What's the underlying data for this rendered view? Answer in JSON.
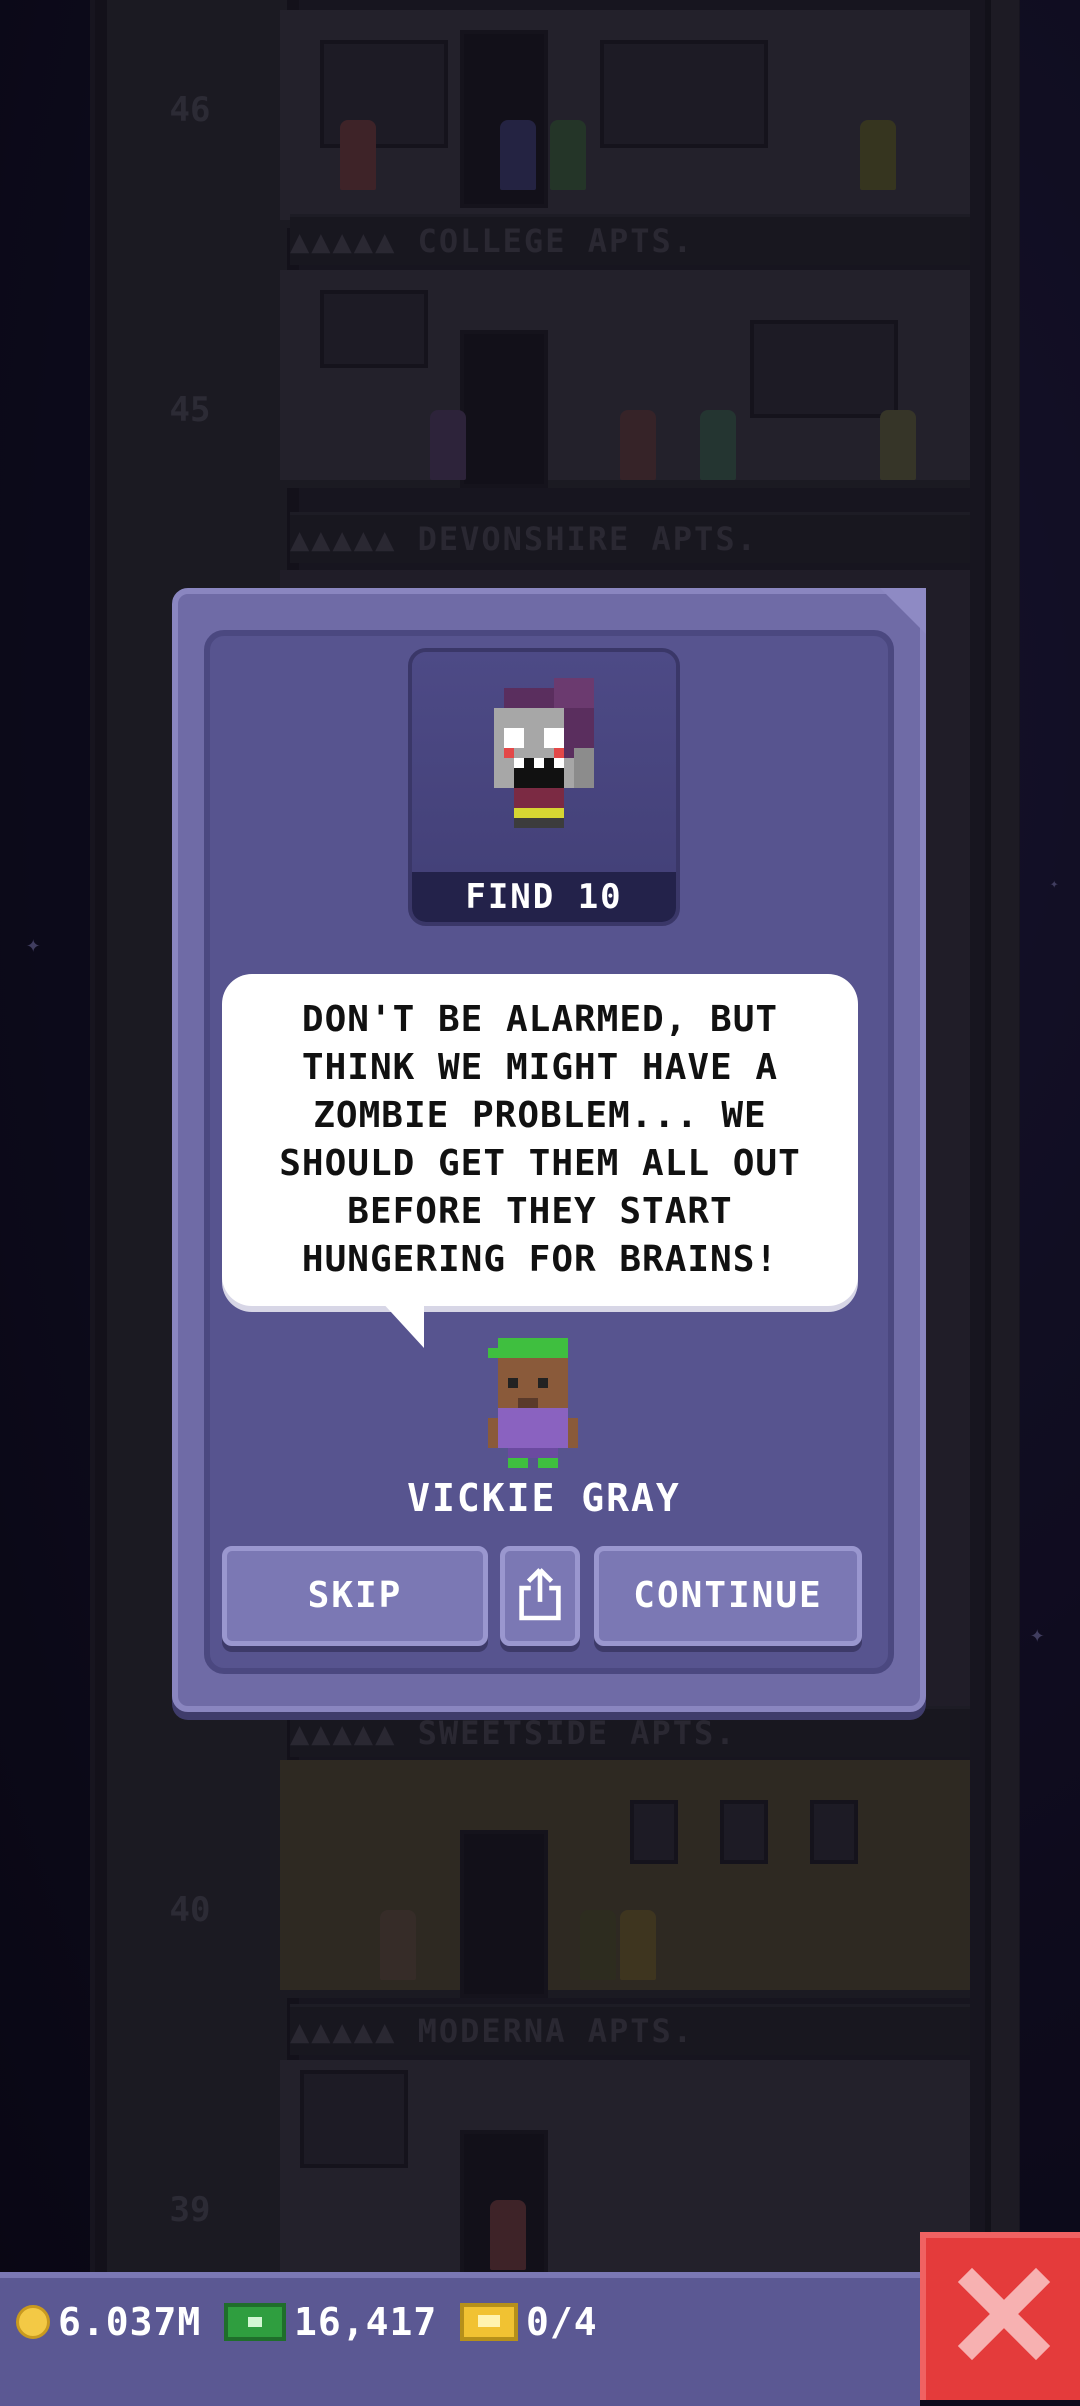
{
  "tower": {
    "floors": [
      {
        "number": "46",
        "label": "▲▲▲▲▲ COLLEGE APTS."
      },
      {
        "number": "45",
        "label": "▲▲▲▲▲ DEVONSHIRE APTS."
      },
      {
        "number": "",
        "label": "▲▲▲▲▲ SWEETSIDE APTS."
      },
      {
        "number": "40",
        "label": "▲▲▲▲▲ MODERNA APTS."
      },
      {
        "number": "39",
        "label": ""
      }
    ]
  },
  "modal": {
    "portrait_label": "FIND 10",
    "portrait_icon": "zombie-icon",
    "message": "DON'T BE ALARMED, BUT THINK WE MIGHT HAVE A ZOMBIE PROBLEM... WE SHOULD GET THEM ALL OUT BEFORE THEY START HUNGERING FOR BRAINS!",
    "speaker_name": "VICKIE GRAY",
    "buttons": {
      "skip": "SKIP",
      "continue": "CONTINUE",
      "share_icon": "share-icon"
    }
  },
  "status_bar": {
    "coins": "6.037M",
    "bux": "16,417",
    "tickets": "0/4",
    "close_icon": "close-icon"
  },
  "colors": {
    "modal_bg": "#57548f",
    "accent_red": "#e43b3b",
    "bar_bg": "#5b5893"
  }
}
